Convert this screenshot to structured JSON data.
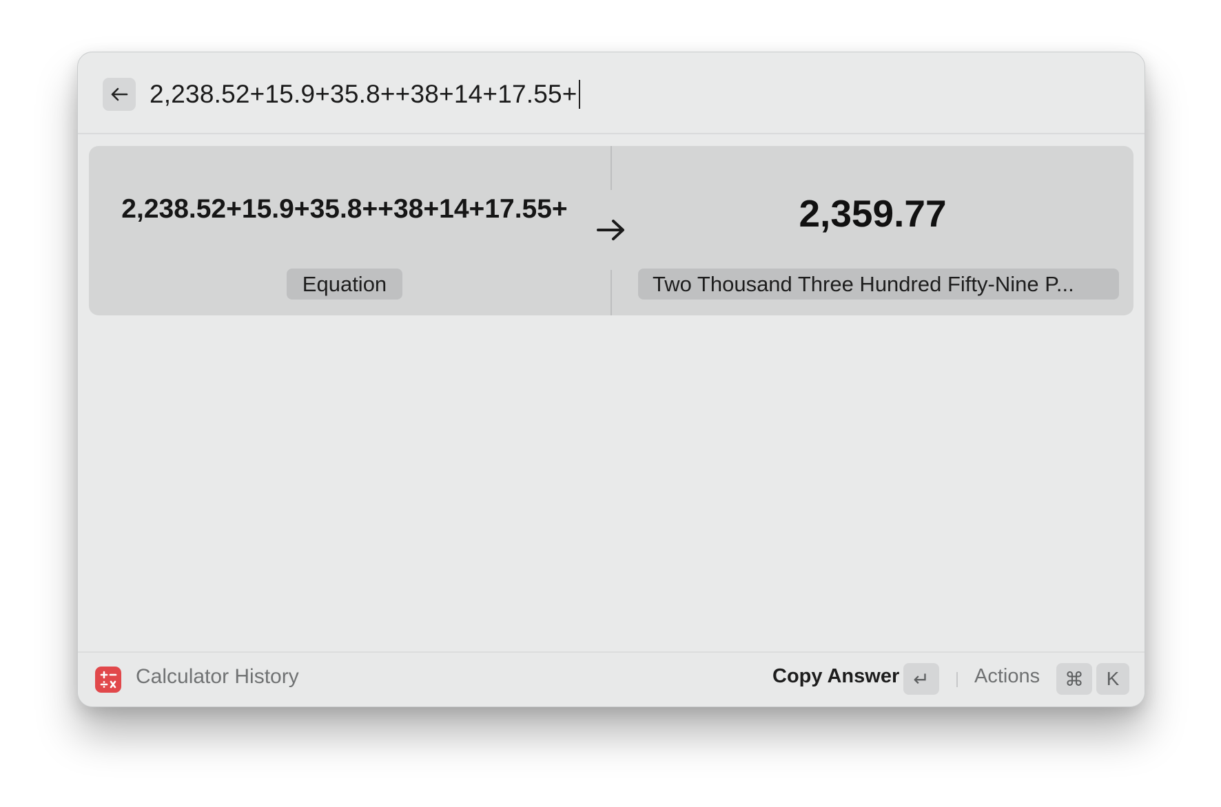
{
  "search": {
    "query": "2,238.52+15.9+35.8++38+14+17.55+"
  },
  "result": {
    "equation": "2,238.52+15.9+35.8++38+14+17.55+",
    "equation_label": "Equation",
    "answer": "2,359.77",
    "answer_words": "Two Thousand Three Hundred Fifty-Nine P..."
  },
  "footer": {
    "title": "Calculator History",
    "primary_action": "Copy Answer",
    "enter_key": "↵",
    "actions_label": "Actions",
    "cmd_key": "⌘",
    "k_key": "K"
  },
  "icons": {
    "back": "arrow-left-icon",
    "result_arrow": "arrow-right-icon",
    "app": "calculator-icon",
    "app_color": "#e1484b"
  }
}
